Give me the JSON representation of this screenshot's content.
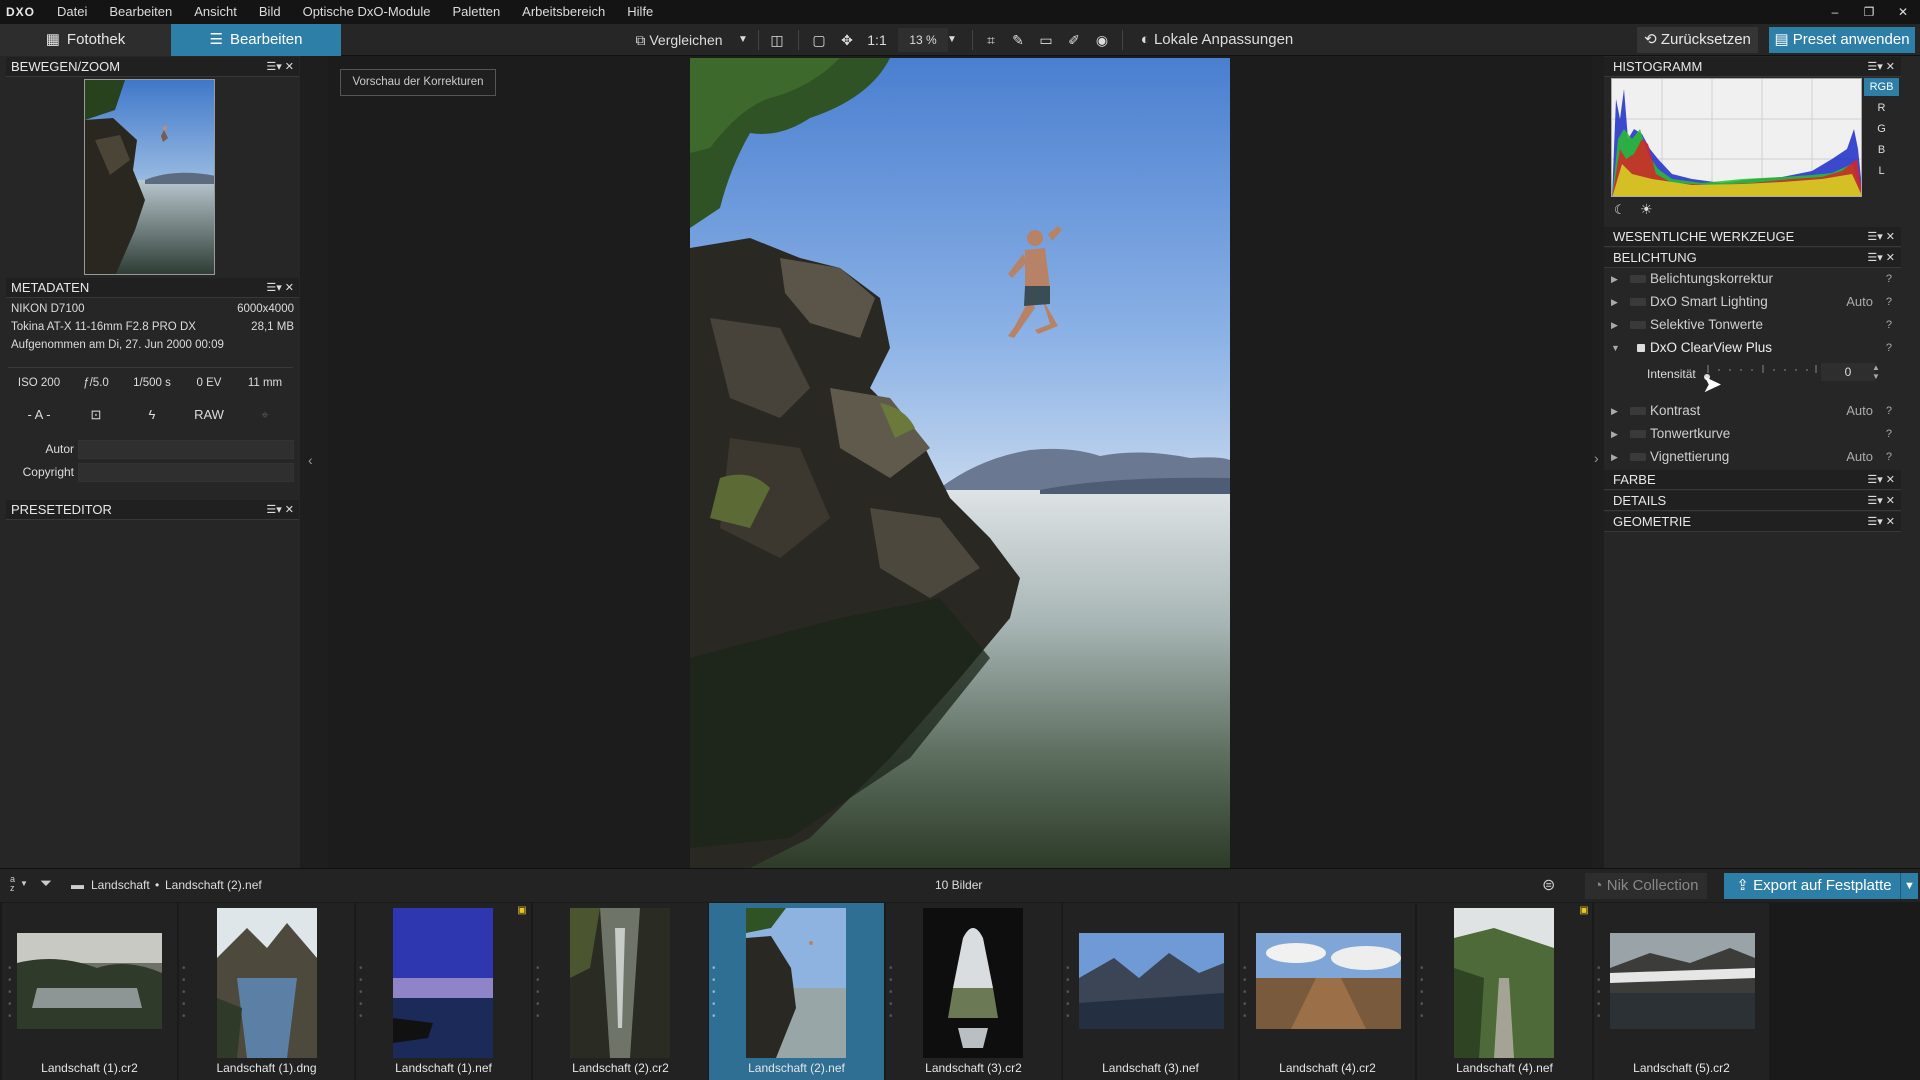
{
  "app": {
    "logo": "DXO"
  },
  "menu": [
    "Datei",
    "Bearbeiten",
    "Ansicht",
    "Bild",
    "Optische DxO-Module",
    "Paletten",
    "Arbeitsbereich",
    "Hilfe"
  ],
  "window_controls": {
    "minimize": "–",
    "restore": "❐",
    "close": "✕"
  },
  "tabs": {
    "fotothek": "Fotothek",
    "bearbeiten": "Bearbeiten"
  },
  "toolbar": {
    "compare_label": "Vergleichen",
    "one_to_one": "1:1",
    "zoom": "13 %",
    "local_adjust": "Lokale Anpassungen",
    "reset": "Zurücksetzen",
    "apply_preset": "Preset anwenden"
  },
  "left_panel": {
    "move_zoom_title": "BEWEGEN/ZOOM",
    "metadata_title": "METADATEN",
    "camera": "NIKON D7100",
    "resolution": "6000x4000",
    "lens": "Tokina AT-X 11-16mm F2.8 PRO DX",
    "filesize": "28,1 MB",
    "taken": "Aufgenommen am Di, 27. Jun 2000 00:09",
    "exif": [
      "ISO 200",
      "ƒ/5.0",
      "1/500 s",
      "0 EV",
      "11 mm"
    ],
    "exposure_mode": "- A -",
    "raw": "RAW",
    "author_label": "Autor",
    "copyright_label": "Copyright",
    "preset_editor_title": "PRESETEDITOR"
  },
  "main": {
    "preview_label": "Vorschau der Korrekturen"
  },
  "right_panel": {
    "histogram_title": "HISTOGRAMM",
    "channels": [
      "RGB",
      "R",
      "G",
      "B",
      "L"
    ],
    "essential_title": "WESENTLICHE WERKZEUGE",
    "exposure_title": "BELICHTUNG",
    "tools": [
      {
        "name": "Belichtungskorrektur",
        "auto": ""
      },
      {
        "name": "DxO Smart Lighting",
        "auto": "Auto"
      },
      {
        "name": "Selektive Tonwerte",
        "auto": ""
      },
      {
        "name": "DxO ClearView Plus",
        "auto": ""
      },
      {
        "name": "Kontrast",
        "auto": "Auto"
      },
      {
        "name": "Tonwertkurve",
        "auto": ""
      },
      {
        "name": "Vignettierung",
        "auto": "Auto"
      }
    ],
    "intensity_label": "Intensität",
    "intensity_value": "0",
    "intensity_level": 0,
    "farbe_title": "FARBE",
    "details_title": "DETAILS",
    "geometrie_title": "GEOMETRIE",
    "help": "?"
  },
  "statusbar": {
    "sort": "a\nz",
    "breadcrumb_folder": "Landschaft",
    "breadcrumb_sep": "•",
    "breadcrumb_file": "Landschaft (2).nef",
    "count": "10 Bilder",
    "nik": "Nik Collection",
    "export": "Export auf Festplatte"
  },
  "filmstrip": [
    {
      "name": "Landschaft (1).cr2",
      "selected": false,
      "badge": false
    },
    {
      "name": "Landschaft (1).dng",
      "selected": false,
      "badge": false
    },
    {
      "name": "Landschaft (1).nef",
      "selected": false,
      "badge": true
    },
    {
      "name": "Landschaft (2).cr2",
      "selected": false,
      "badge": false
    },
    {
      "name": "Landschaft (2).nef",
      "selected": true,
      "badge": false
    },
    {
      "name": "Landschaft (3).cr2",
      "selected": false,
      "badge": false
    },
    {
      "name": "Landschaft (3).nef",
      "selected": false,
      "badge": false
    },
    {
      "name": "Landschaft (4).cr2",
      "selected": false,
      "badge": false
    },
    {
      "name": "Landschaft (4).nef",
      "selected": false,
      "badge": true
    },
    {
      "name": "Landschaft (5).cr2",
      "selected": false,
      "badge": false
    }
  ]
}
